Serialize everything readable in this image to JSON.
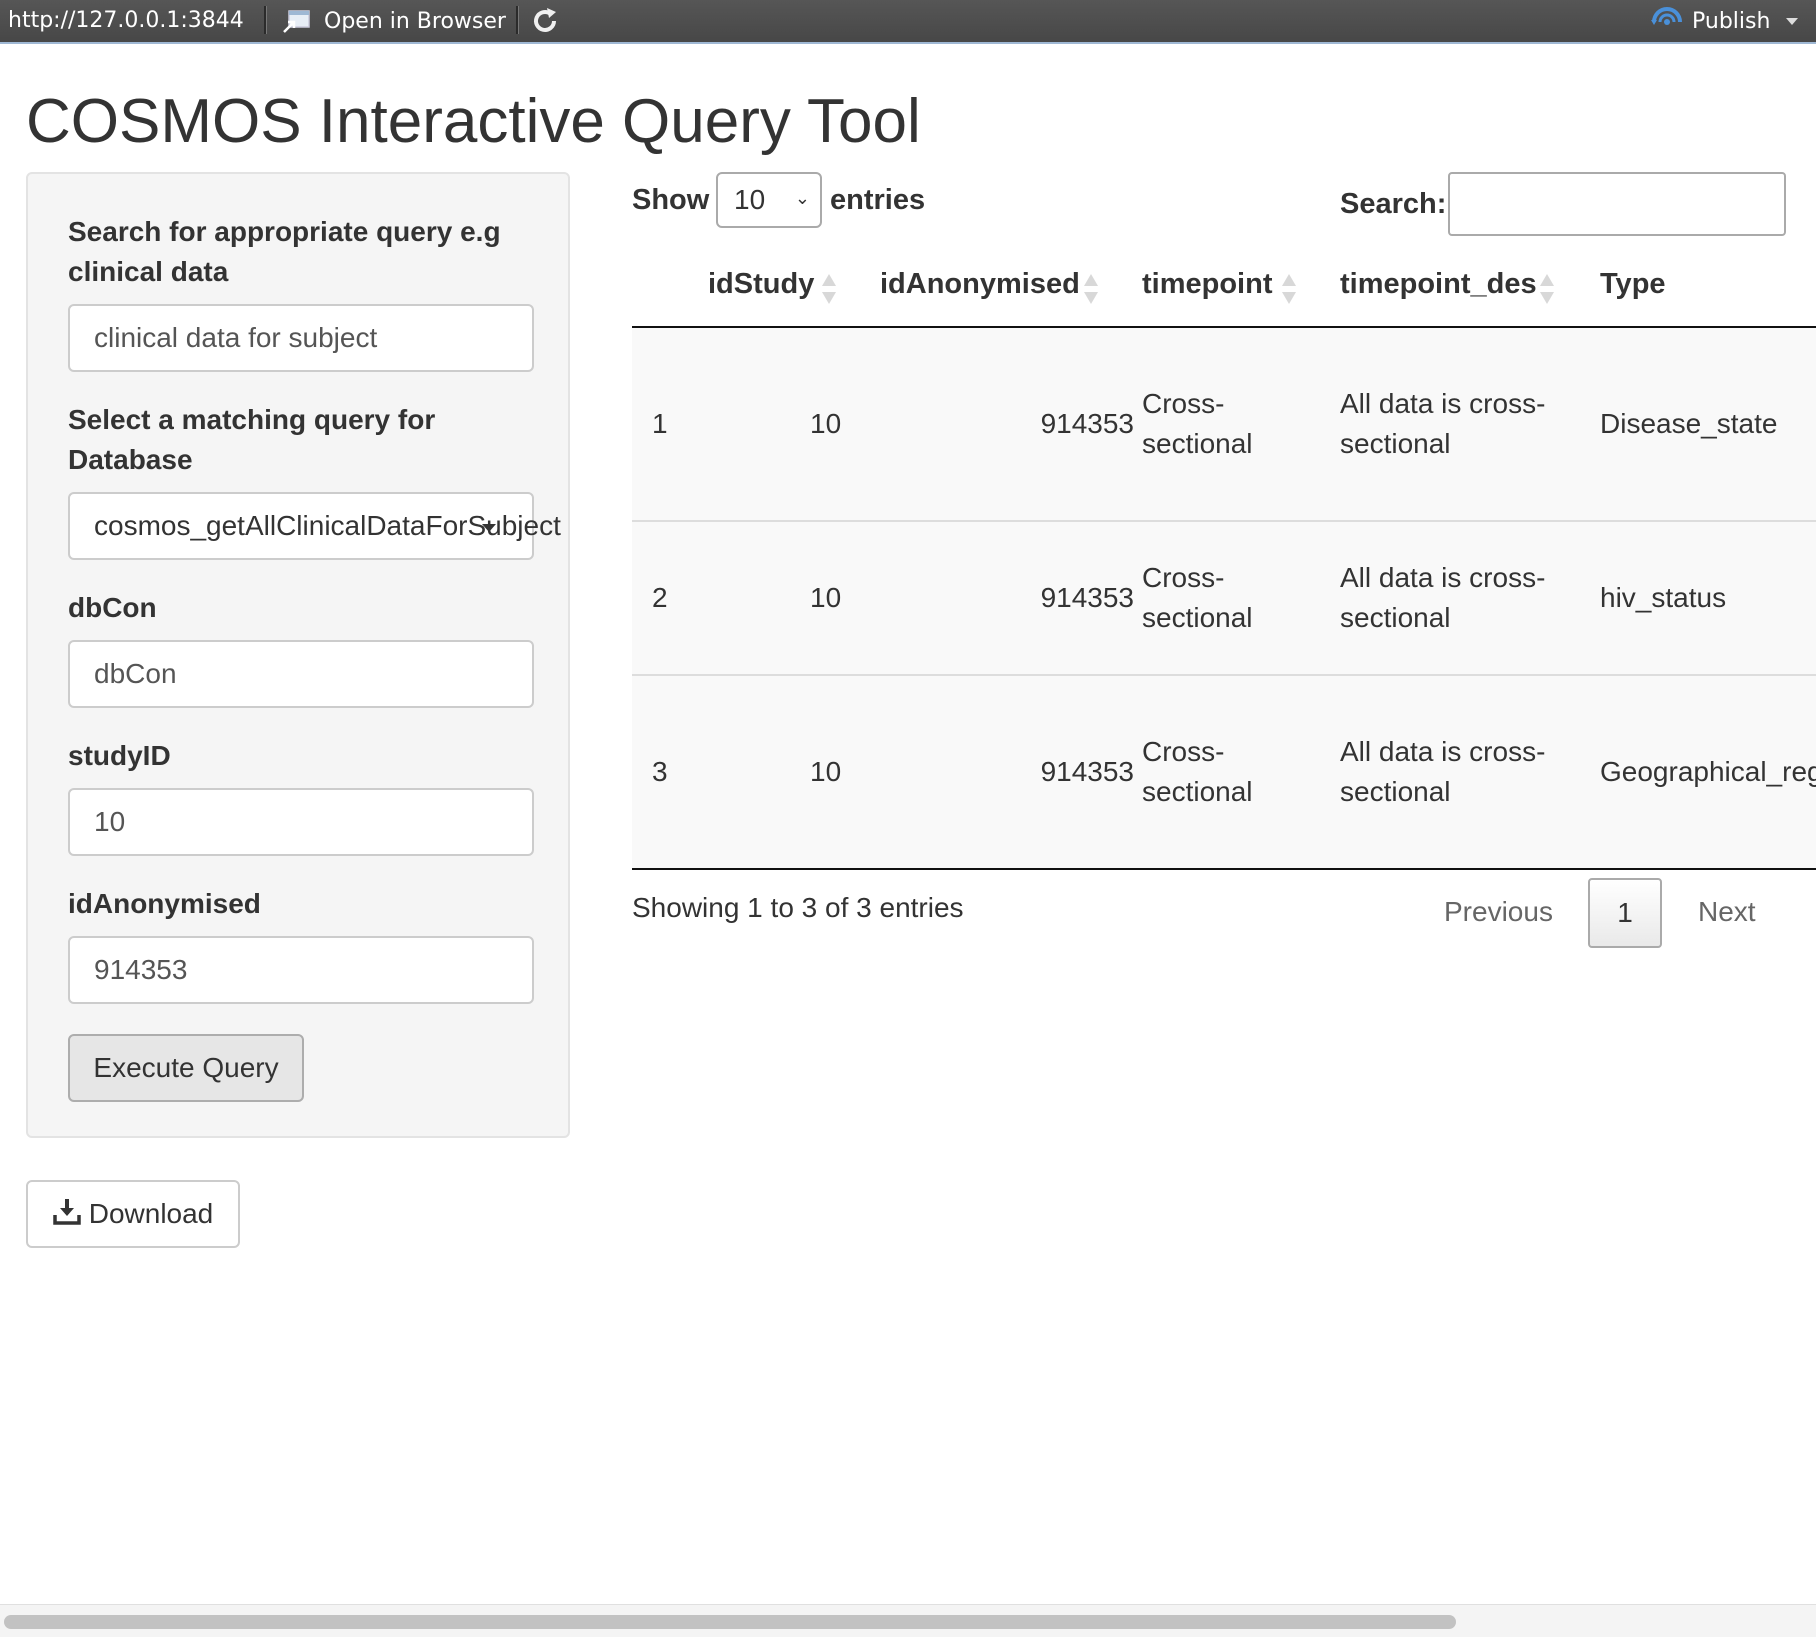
{
  "viewer": {
    "url": "http://127.0.0.1:3844",
    "open_in_browser": "Open in Browser",
    "publish": "Publish"
  },
  "page": {
    "title": "COSMOS Interactive Query Tool"
  },
  "sidebar": {
    "search_label": "Search for appropriate query e.g clinical data",
    "search_label_line1": "Search for appropriate query e.g",
    "search_label_line2": "clinical data",
    "search_value": "clinical data for subject",
    "select_label_line1": "Select a matching query for",
    "select_label_line2": "Database",
    "select_value": "cosmos_getAllClinicalDataForSubject",
    "dbcon_label": "dbCon",
    "dbcon_value": "dbCon",
    "studyid_label": "studyID",
    "studyid_value": "10",
    "idanon_label": "idAnonymised",
    "idanon_value": "914353",
    "execute_label": "Execute Query"
  },
  "download": {
    "label": "Download"
  },
  "table": {
    "show_label": "Show",
    "length_value": "10",
    "entries_label": "entries",
    "search_label": "Search:",
    "columns": [
      "",
      "idStudy",
      "idAnonymised",
      "timepoint",
      "timepoint_des",
      "Type"
    ],
    "rows": [
      {
        "n": "1",
        "idStudy": "10",
        "idAnonymised": "914353",
        "timepoint_l1": "Cross-",
        "timepoint_l2": "sectional",
        "des_l1": "All data is cross-",
        "des_l2": "sectional",
        "type": "Disease_state"
      },
      {
        "n": "2",
        "idStudy": "10",
        "idAnonymised": "914353",
        "timepoint_l1": "Cross-",
        "timepoint_l2": "sectional",
        "des_l1": "All data is cross-",
        "des_l2": "sectional",
        "type": "hiv_status"
      },
      {
        "n": "3",
        "idStudy": "10",
        "idAnonymised": "914353",
        "timepoint_l1": "Cross-",
        "timepoint_l2": "sectional",
        "des_l1": "All data is cross-",
        "des_l2": "sectional",
        "type": "Geographical_reg"
      }
    ],
    "info": "Showing 1 to 3 of 3 entries",
    "previous": "Previous",
    "current_page": "1",
    "next": "Next"
  },
  "colors": {
    "toolbar": "#4d4d4d",
    "panel": "#f5f5f5",
    "row_bg": "#f9f9f9",
    "publish_icon": "#4a90d9"
  }
}
